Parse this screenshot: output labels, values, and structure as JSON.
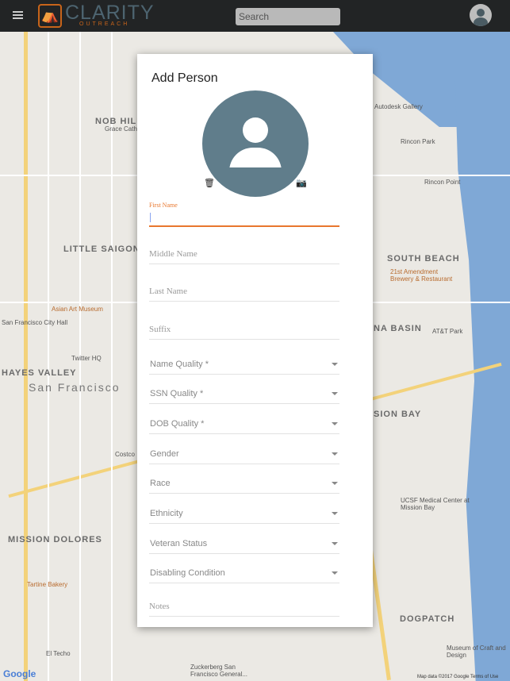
{
  "app": {
    "logo_text": "CLARITY",
    "logo_sub": "OUTREACH",
    "search_placeholder": "Search"
  },
  "dialog": {
    "title": "Add Person",
    "first_name_label": "First Name",
    "text_fields": [
      "Middle Name",
      "Last Name",
      "Suffix"
    ],
    "select_fields": [
      "Name Quality *",
      "SSN Quality *",
      "DOB Quality *",
      "Gender",
      "Race",
      "Ethnicity",
      "Veteran Status",
      "Disabling Condition"
    ],
    "notes_label": "Notes"
  },
  "map": {
    "labels": [
      "NOB HILL",
      "LITTLE SAIGON",
      "HAYES VALLEY",
      "San Francisco",
      "MISSION DOLORES",
      "SOUTH BEACH",
      "NA BASIN",
      "SION BAY",
      "DOGPATCH",
      "Rincon Park",
      "Rincon Point",
      "Asian Art Museum",
      "San Francisco City Hall",
      "Twitter HQ",
      "21st Amendment Brewery & Restaurant",
      "AT&T Park",
      "UCSF Medical Center at Mission Bay",
      "Tartine Bakery",
      "El Techo",
      "Zuckerberg San Francisco General...",
      "Museum of Craft and Design",
      "Autodesk Gallery",
      "Costco",
      "Grace Cathedral"
    ],
    "google": "Google",
    "attribution": "Map data ©2017 Google   Terms of Use"
  },
  "colors": {
    "accent": "#e8772e",
    "topbar": "#222425",
    "avatar": "#607d8b",
    "water": "#7fa8d6"
  }
}
